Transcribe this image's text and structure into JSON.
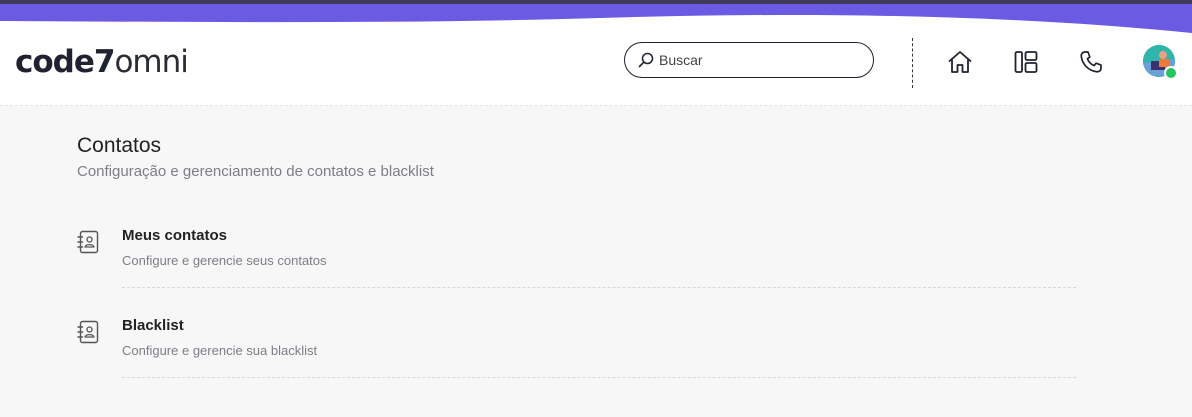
{
  "header": {
    "logo": {
      "bold": "code7",
      "light": "omni"
    },
    "search": {
      "placeholder": "Buscar",
      "icon": "search-icon"
    },
    "nav": [
      {
        "name": "home",
        "icon": "home-icon"
      },
      {
        "name": "layout",
        "icon": "layout-icon"
      },
      {
        "name": "phone",
        "icon": "phone-icon"
      }
    ],
    "user": {
      "status": "online",
      "status_color": "#22c55e"
    }
  },
  "page": {
    "title": "Contatos",
    "subtitle": "Configuração e gerenciamento de contatos e blacklist"
  },
  "items": [
    {
      "title": "Meus contatos",
      "description": "Configure e gerencie seus contatos",
      "icon": "contact-book-icon"
    },
    {
      "title": "Blacklist",
      "description": "Configure e gerencie sua blacklist",
      "icon": "contact-book-icon"
    }
  ],
  "colors": {
    "accent": "#6b5be2",
    "accent_dark": "#4b4390",
    "background": "#f7f7f7"
  }
}
